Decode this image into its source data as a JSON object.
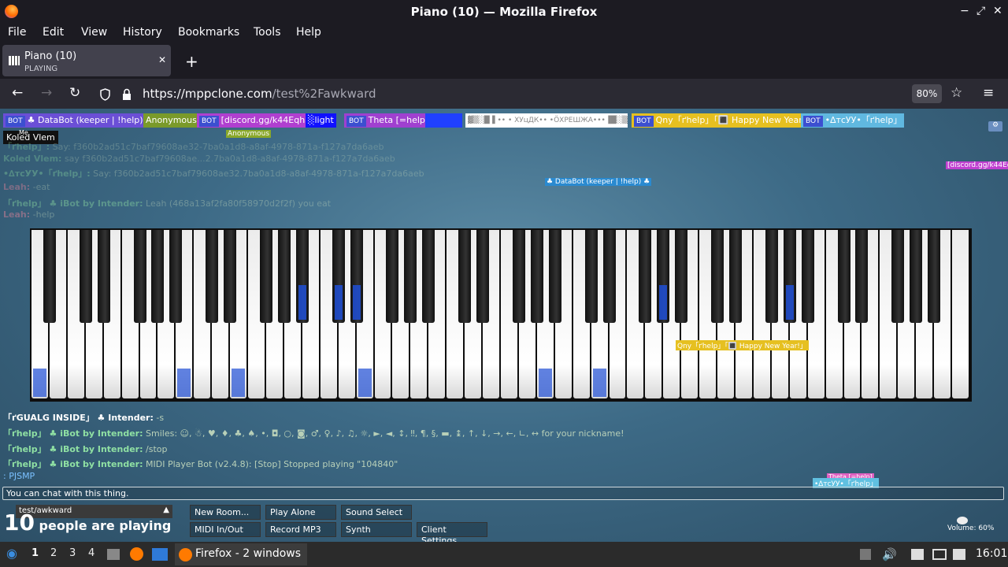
{
  "window": {
    "title": "Piano (10) — Mozilla Firefox",
    "min": "−",
    "max": "⤢",
    "close": "✕"
  },
  "menu": [
    "File",
    "Edit",
    "View",
    "History",
    "Bookmarks",
    "Tools",
    "Help"
  ],
  "tab": {
    "title": "Piano (10)",
    "subtitle": "PLAYING",
    "close": "✕",
    "new": "+"
  },
  "nav": {
    "back": "←",
    "forward": "→",
    "reload": "↻",
    "url_host": "https://mppclone.com",
    "url_path": "/test%2Fawkward",
    "zoom": "80%",
    "star": "☆",
    "menu": "≡"
  },
  "users": [
    {
      "bot": "BOT",
      "name": "♣ DataBot (keeper | !help) ♣",
      "color": "#6b4fd6"
    },
    {
      "bot": "",
      "name": "Anonymous",
      "color": "#7a9a2a"
    },
    {
      "bot": "BOT",
      "name": "[discord.gg/k44Eqha]",
      "color": "#b03fd0"
    },
    {
      "bot": "",
      "name": "░light",
      "color": "#1010ff"
    },
    {
      "bot": "BOT",
      "name": "Theta [=help]",
      "color": "#a040d0"
    },
    {
      "bot": "",
      "name": " ",
      "color": "#2040ff"
    },
    {
      "bot": "",
      "name": "▓▒░█▐ •• • ХУцДК•• •ÖХРЕШЖА•••▐█░▒▓",
      "color": "#ffffff"
    },
    {
      "bot": "BOT",
      "name": "Qny「ґhelp」「🔳 Happy New Year!」",
      "color": "#e6c020"
    },
    {
      "bot": "BOT",
      "name": "•∆тсУУ•「ґhelp」",
      "color": "#60b8e0"
    }
  ],
  "floating_labels": {
    "tooltip": "Koled Vlem",
    "me": "Me",
    "anon": "Anonymous",
    "databot": "♣ DataBot (keeper | !help) ♣",
    "discord": "[discord.gg/k44Eqh",
    "qny": "Qny「ґhelp」「🔳 Happy New Year!」",
    "theta": "Theta [=help]",
    "tcv": "•∆тсУУ•「ґhelp」"
  },
  "chat": [
    {
      "name": "「ґhelp」:",
      "text": "Say: f360b2ad51c7baf79608ae32-7ba0a1d8-a8af-4978-871a-f127a7da6aeb"
    },
    {
      "name": "Koled Vlem:",
      "text": "say f360b2ad51c7baf79608ae...2.7ba0a1d8-a8af-4978-871a-f127a7da6aeb"
    },
    {
      "name": "•∆тсУУ•「ґhelp」:",
      "text": "Say: f360b2ad51c7baf79608ae32.7ba0a1d8-a8af-4978-871a-f127a7da6aeb"
    },
    {
      "name": "Leah:",
      "text": "-eat"
    },
    {
      "name": "「ґhelp」 ♣ iBot by Intender:",
      "text": "Leah (468a13af2fa80f58970d2f2f) you eat"
    },
    {
      "name": "Leah:",
      "text": "-help"
    },
    {
      "name": "「ґGUALG INSIDE」 ♣ Intender:",
      "text": "-s"
    },
    {
      "name": "「ґhelp」 ♣ iBot by Intender:",
      "text": "Smiles: ☺, ☃, ♥, ♦, ♣, ♠, •, ◘, ○, ◙, ♂, ♀, ♪, ♫, ☼, ►, ◄, ↕, ‼, ¶, §, ▬, ↨, ↑, ↓, →, ←, ∟, ↔ for your nickname!"
    },
    {
      "name": "「ґhelp」 ♣ iBot by Intender:",
      "text": "/stop"
    },
    {
      "name": "「ґhelp」 ♣ iBot by Intender:",
      "text": "MIDI Player Bot (v2.4.8): [Stop] Stopped playing \"104840\""
    },
    {
      "name": "",
      "text": ": PJSMP"
    }
  ],
  "chat_input_placeholder": "You can chat with this thing.",
  "controls": {
    "room": "test/awkward",
    "new_room": "New Room...",
    "play_alone": "Play Alone",
    "sound_select": "Sound Select",
    "midi": "MIDI In/Out",
    "record": "Record MP3",
    "synth": "Synth",
    "client_settings": "Client Settings",
    "count_num": "10",
    "count_text": "people are playing",
    "volume": "Volume: 60%"
  },
  "taskbar": {
    "workspaces": [
      "1",
      "2",
      "3",
      "4"
    ],
    "app": "Firefox - 2 windows",
    "clock": "16:01"
  },
  "pressed_white_keys": [
    0,
    8,
    11,
    18,
    28,
    31
  ],
  "pressed_black_keys": [
    10,
    11,
    12,
    24,
    29
  ]
}
